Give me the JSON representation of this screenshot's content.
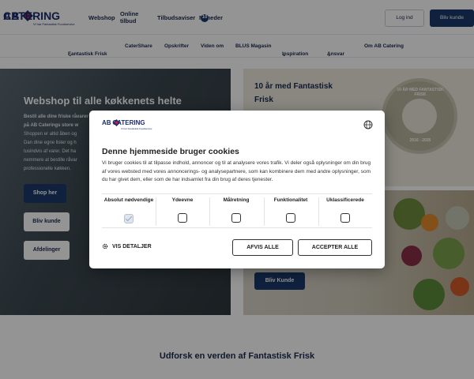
{
  "header": {
    "logo_ab": "AB",
    "logo_catering": "CATERING",
    "logo_tagline": "Vi har Fantastisk Foodservice",
    "nav": [
      {
        "label": "Webshop"
      },
      {
        "label": "Online tilbud"
      },
      {
        "label": "Tilbudsaviser"
      },
      {
        "label": "Nyheder",
        "badge": "10"
      }
    ],
    "login_label": "Log ind",
    "signup_label": "Bliv kunde"
  },
  "subnav": [
    {
      "label": "Fantastisk Frisk",
      "dropdown": true
    },
    {
      "label": "CaterShare",
      "dropdown": false
    },
    {
      "label": "Opskrifter",
      "dropdown": false
    },
    {
      "label": "Viden om",
      "dropdown": false
    },
    {
      "label": "BLUS Magasin",
      "dropdown": false
    },
    {
      "label": "Inspiration",
      "dropdown": true
    },
    {
      "label": "Ansvar",
      "dropdown": true
    },
    {
      "label": "Om AB Catering",
      "dropdown": false
    }
  ],
  "hero": {
    "title": "Webshop til alle køkkenets helte",
    "lines": [
      "Bestil alle dine friske råvarer",
      "på AB Caterings store w",
      "Shoppen er altid åben og",
      "Dan dine egne lister og h",
      "tusindvis af varer. Det ha",
      "nemmere at bestille råvar",
      "professionelle køkken."
    ],
    "shop_label": "Shop her",
    "signup_label": "Bliv kunde",
    "departments_label": "Afdelinger"
  },
  "promo": {
    "title_line1": "10 år med Fantastisk",
    "title_line2": "Frisk",
    "seal_text": "10 ÅR MED FANTASTISK FRISK",
    "seal_years": "2016 - 2026",
    "signup_label": "Bliv Kunde"
  },
  "section_title": "Udforsk en verden af Fantastisk Frisk",
  "cookie_dialog": {
    "title": "Denne hjemmeside bruger cookies",
    "text": "Vi bruger cookies til at tilpasse indhold, annoncer og til at analysere vores trafik. Vi deler også oplysninger om din brug af vores websted med vores annoncerings- og analysepartnere, som kan kombinere dem med andre oplysninger, som du har givet dem, eller som de har indsamlet fra din brug af deres tjenester.",
    "categories": [
      {
        "label": "Absolut nødvendige",
        "checked": true,
        "disabled": true
      },
      {
        "label": "Ydeevne",
        "checked": false
      },
      {
        "label": "Målretning",
        "checked": false
      },
      {
        "label": "Funktionalitet",
        "checked": false
      },
      {
        "label": "Uklassificerede",
        "checked": false
      }
    ],
    "details_label": "VIS DETALJER",
    "reject_label": "AFVIS ALLE",
    "accept_label": "ACCEPTER ALLE"
  },
  "colors": {
    "brand_navy": "#1b3a6b",
    "brand_red": "#d2233c",
    "overlay": "rgba(0,0,0,0.42)"
  }
}
